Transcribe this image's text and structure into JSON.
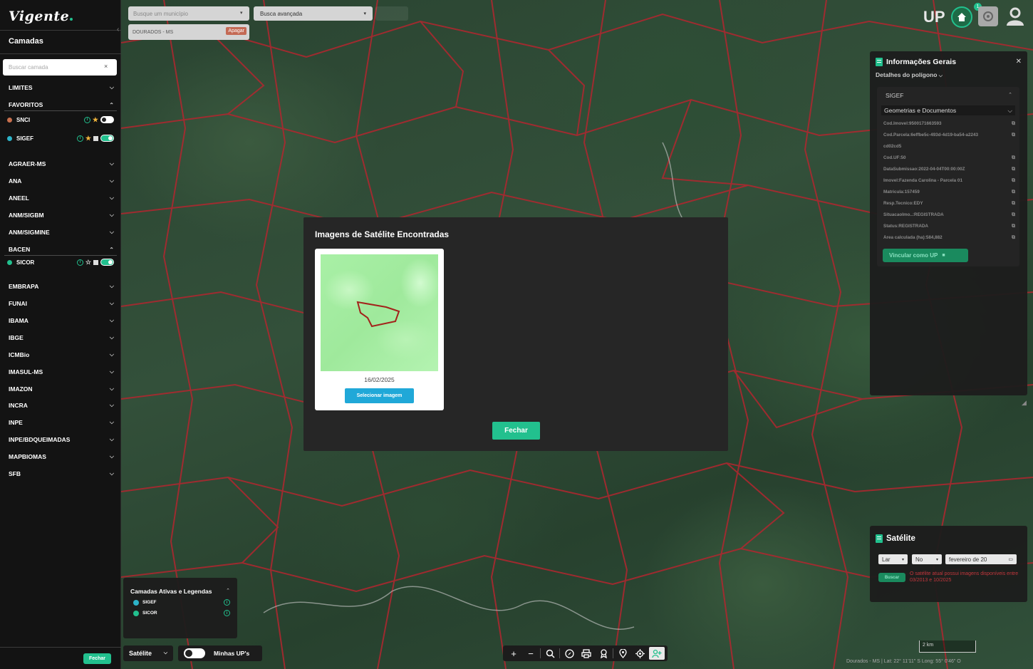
{
  "app": {
    "logo": "Vigente",
    "up_logo": "UP",
    "notification_count": "1"
  },
  "sidebar": {
    "title": "Camadas",
    "search_placeholder": "Buscar camada",
    "search_clear": "×",
    "groups": [
      {
        "label": "LIMITES"
      },
      {
        "label": "FAVORITOS"
      },
      {
        "label": "AGRAER-MS"
      },
      {
        "label": "ANA"
      },
      {
        "label": "ANEEL"
      },
      {
        "label": "ANM/SIGBM"
      },
      {
        "label": "ANM/SIGMINE"
      },
      {
        "label": "BACEN"
      },
      {
        "label": "EMBRAPA"
      },
      {
        "label": "FUNAI"
      },
      {
        "label": "IBAMA"
      },
      {
        "label": "IBGE"
      },
      {
        "label": "ICMBio"
      },
      {
        "label": "IMASUL-MS"
      },
      {
        "label": "IMAZON"
      },
      {
        "label": "INCRA"
      },
      {
        "label": "INPE"
      },
      {
        "label": "INPE/BDQUEIMADAS"
      },
      {
        "label": "MAPBIOMAS"
      },
      {
        "label": "SFB"
      }
    ],
    "layers": [
      {
        "label": "SNCI",
        "color": "#c8704e",
        "enabled": false
      },
      {
        "label": "SIGEF",
        "color": "#2db4c9",
        "enabled": true
      },
      {
        "label": "SICOR",
        "color": "#22c08e",
        "enabled": true
      }
    ],
    "close_button": "Fechar"
  },
  "search": {
    "municipality_placeholder": "Busque um município",
    "advanced": "Busca avançada",
    "selected_municipality": "DOURADOS - MS",
    "delete_button": "Apagar"
  },
  "info_panel": {
    "title": "Informações Gerais",
    "subtitle": "Detalhes do polígono",
    "source": "SIGEF",
    "section": "Geometrias e Documentos",
    "fields": [
      "Cod.Imovel:9500171663593",
      "Cod.Parcela:6effbe5c-493d-4d19-ba54-a2243",
      "cd02cd5",
      "Cod.UF:50",
      "DataSubmissao:2022-04-04T00:00:00Z",
      "Imovel:Fazenda Carolina - Parcela 01",
      "Matricula:157459",
      "Resp.Tecnico:EDY",
      "SituacaoImo..:REGISTRADA",
      "Status:REGISTRADA",
      "Área calculada (ha):584,882"
    ],
    "link_button": "Vincular como UP"
  },
  "modal": {
    "title": "Imagens de Satélite Encontradas",
    "image_date": "16/02/2025",
    "select_button": "Selecionar imagem",
    "close_button": "Fechar"
  },
  "satellite_panel": {
    "title": "Satélite",
    "select1": "Lar",
    "select2": "No",
    "month": "fevereiro de 20",
    "search_button": "Buscar",
    "note": "O satélite atual possui imagens disponíveis entre 03/2013 e 10/2025"
  },
  "legend": {
    "title": "Camadas Ativas e Legendas",
    "items": [
      {
        "label": "SIGEF",
        "color": "#2db4c9"
      },
      {
        "label": "SICOR",
        "color": "#22c08e"
      }
    ]
  },
  "bottom": {
    "basemap": "Satélite",
    "my_ups": "Minhas UP's",
    "scale": "2 km",
    "coords": "Dourados - MS | Lat: 22° 11'11\" S Long: 55° 0'46\" O"
  },
  "colors": {
    "accent": "#22c08e",
    "parcel_line": "#b3262f",
    "select_blue": "#20a8d8"
  }
}
